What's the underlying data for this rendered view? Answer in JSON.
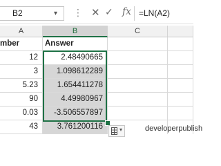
{
  "formula_bar": {
    "name_box": "B2",
    "dropdown": "▾",
    "dots": "⋮",
    "cancel": "✕",
    "enter": "✓",
    "fx": "fx",
    "formula": "=LN(A2)"
  },
  "columns": [
    "A",
    "B",
    "C"
  ],
  "selected_column": "B",
  "headers": {
    "a": "mber",
    "b": "Answer"
  },
  "rows": [
    {
      "a": "12",
      "b": "2.48490665"
    },
    {
      "a": "3",
      "b": "1.098612289"
    },
    {
      "a": "5.23",
      "b": "1.654411278"
    },
    {
      "a": "90",
      "b": "4.49980967"
    },
    {
      "a": "0.03",
      "b": "-3.506557897"
    },
    {
      "a": "43",
      "b": "3.761200116"
    }
  ],
  "quick_analysis": {
    "caret": "▾"
  },
  "watermark": "developerpublish",
  "colors": {
    "selection": "#1e7145",
    "selected_fill": "#d6d6d6"
  }
}
